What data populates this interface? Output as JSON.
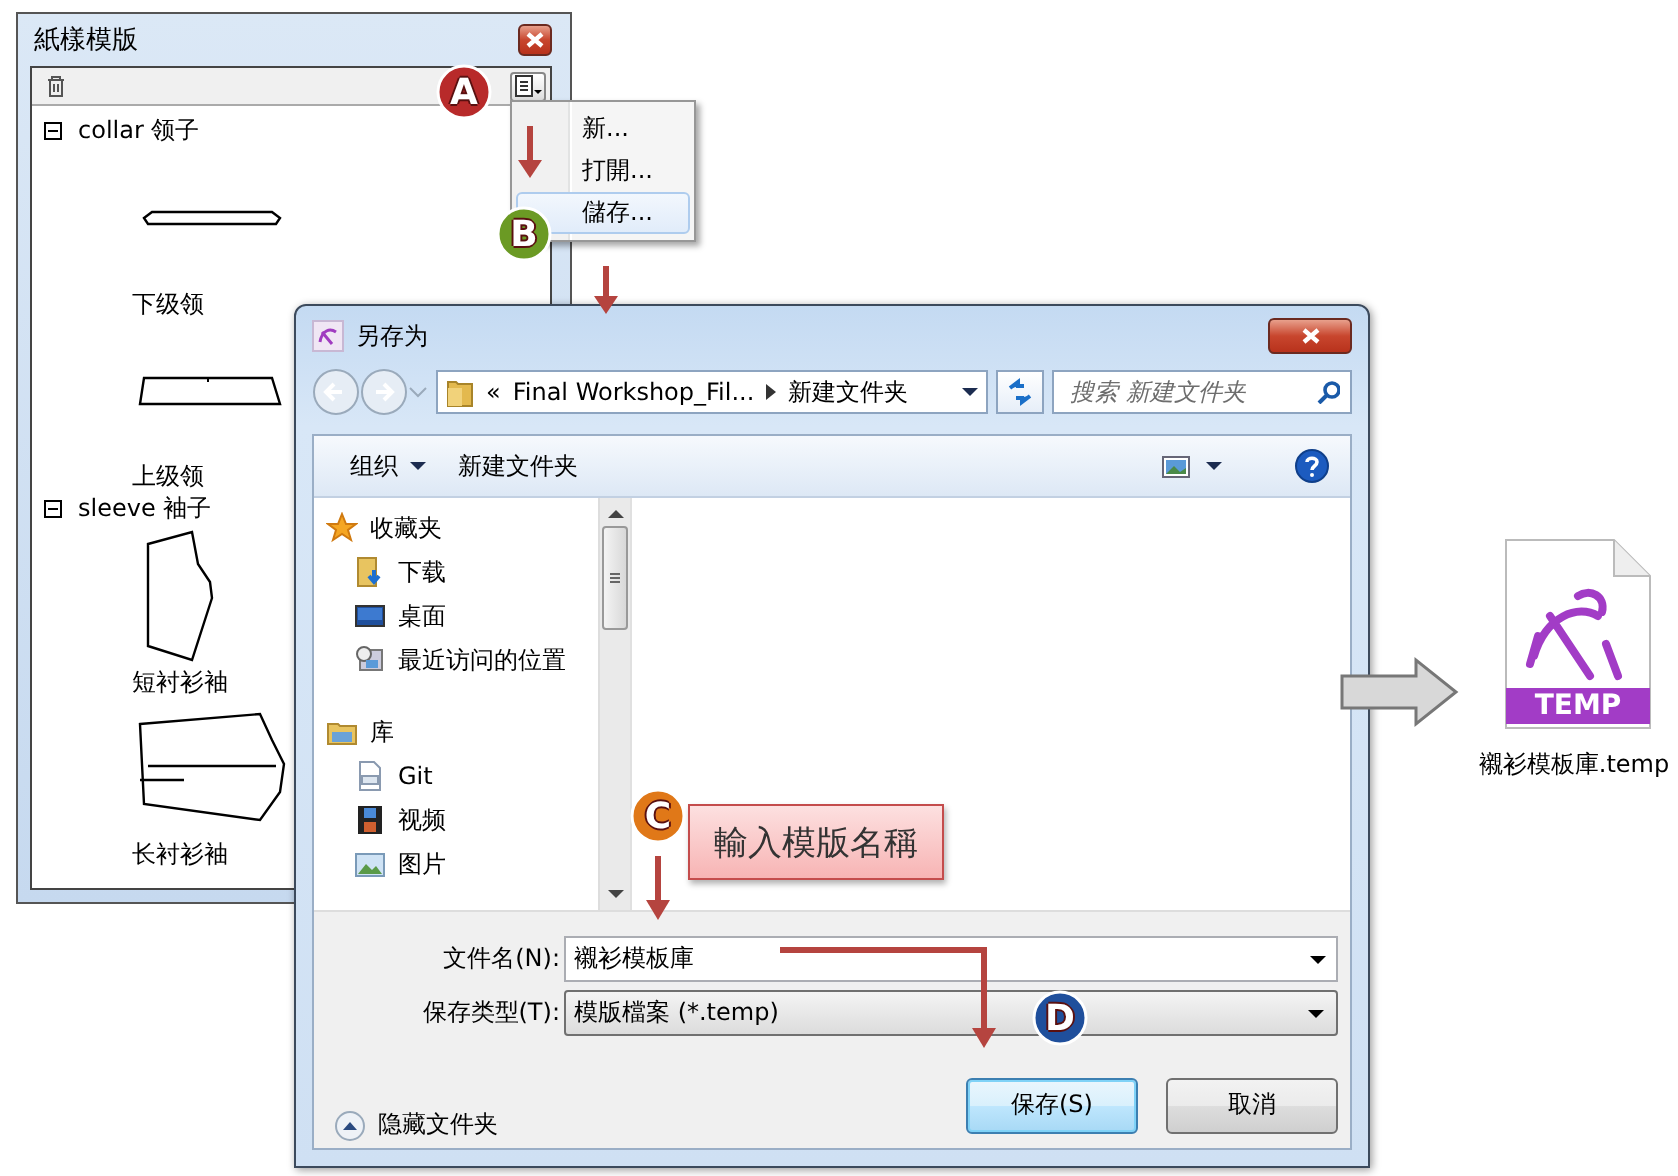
{
  "pattern_panel": {
    "title": "紙樣模版",
    "tree": [
      {
        "label": "collar 领子",
        "expanded": true,
        "children": [
          {
            "label": "下级领",
            "kind": "band"
          },
          {
            "label": "上级领",
            "kind": "stand"
          }
        ]
      },
      {
        "label": "sleeve 袖子",
        "expanded": true,
        "children": [
          {
            "label": "短衬衫袖",
            "kind": "short"
          },
          {
            "label": "长衬衫袖",
            "kind": "long"
          }
        ]
      }
    ]
  },
  "menu": {
    "items": [
      {
        "label": "新...",
        "selected": false
      },
      {
        "label": "打開...",
        "selected": false
      },
      {
        "label": "儲存...",
        "selected": true
      }
    ]
  },
  "save_dialog": {
    "title": "另存为",
    "overflow_mark": "«",
    "breadcrumb": [
      "Final Workshop_Fil...",
      "新建文件夹"
    ],
    "search": {
      "placeholder": "搜索 新建文件夹"
    },
    "toolbar": {
      "organize": "组织",
      "new_folder": "新建文件夹"
    },
    "nav": [
      {
        "label": "收藏夹",
        "kind": "star",
        "children": [
          {
            "label": "下载",
            "kind": "downloads"
          },
          {
            "label": "桌面",
            "kind": "desktop"
          },
          {
            "label": "最近访问的位置",
            "kind": "recent"
          }
        ]
      },
      {
        "label": "库",
        "kind": "library",
        "children": [
          {
            "label": "Git",
            "kind": "git"
          },
          {
            "label": "视频",
            "kind": "video"
          },
          {
            "label": "图片",
            "kind": "pictures"
          }
        ]
      }
    ],
    "fields": [
      {
        "label": "文件名(N):",
        "value": "襯衫模板庫",
        "kind": "editable"
      },
      {
        "label": "保存类型(T):",
        "value": "模版檔案 (*.temp)",
        "kind": "select"
      }
    ],
    "hide_folders": "隐藏文件夹",
    "buttons": [
      {
        "label": "保存(S)",
        "default": true
      },
      {
        "label": "取消",
        "default": false
      }
    ]
  },
  "steps": [
    {
      "label": "A",
      "color": "#b82a2a"
    },
    {
      "label": "B",
      "color": "#6b9a24"
    },
    {
      "label": "C",
      "color": "#e07818"
    },
    {
      "label": "D",
      "color": "#1f4f9c"
    }
  ],
  "callout": {
    "text": "輸入模版名稱"
  },
  "output_file": {
    "icon_label": "TEMP",
    "name": "襯衫模板庫.temp"
  }
}
